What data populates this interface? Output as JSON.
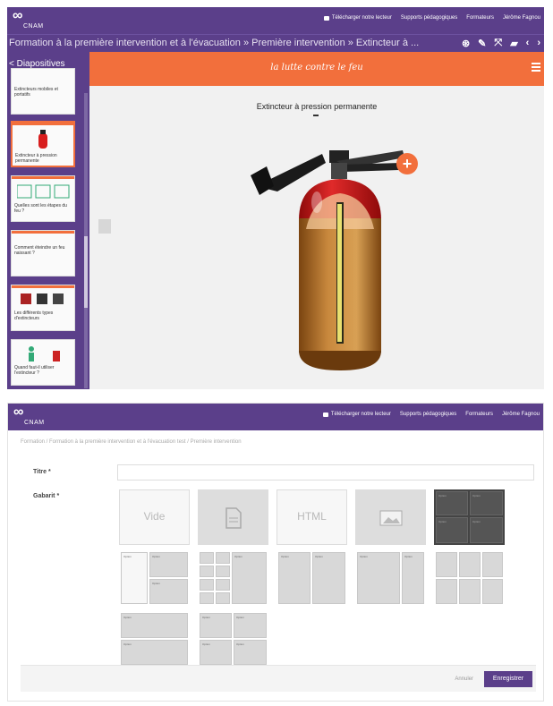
{
  "editor": {
    "app": {
      "logo_text": "CNAM"
    },
    "toplinks": [
      "Télécharger notre lecteur",
      "Supports pédagogiques",
      "Formateurs",
      "Jérôme Fagnou"
    ],
    "breadcrumb": "Formation à la première intervention et à l'évacuation » Première intervention » Extincteur à ...",
    "tools": [
      "share-icon",
      "pencil-icon",
      "expand-icon",
      "folder-icon",
      "chevron-left-icon",
      "chevron-right-icon"
    ],
    "sidebar": {
      "header": "< Diapositives",
      "slides": [
        {
          "caption": "Extincteurs mobiles et portatifs"
        },
        {
          "caption": "Extincteur à pression permanente"
        },
        {
          "caption": "Quelles sont les étapes du feu ?"
        },
        {
          "caption": "Comment éteindre un feu naissant ?"
        },
        {
          "caption": "Les différents types d'extincteurs"
        },
        {
          "caption": "Quand faut-il utiliser l'extincteur ?"
        }
      ]
    },
    "slide_header": "la lutte contre le feu",
    "slide_title": "Extincteur à pression permanente",
    "colors": {
      "brand": "#5b3f8a",
      "accent": "#f26f3c",
      "red": "#d81e1e",
      "body": "#b87730"
    }
  },
  "form": {
    "toplinks": [
      "Télécharger notre lecteur",
      "Supports pédagogiques",
      "Formateurs",
      "Jérôme Fagnou"
    ],
    "breadcrumb": "Formation / Formation à la première intervention et à l'évacuation test / Première intervention",
    "title_label": "Titre *",
    "title_value": "",
    "gabarit_label": "Gabarit *",
    "templates": [
      {
        "name": "Vide"
      },
      {
        "name": "document-icon"
      },
      {
        "name": "HTML"
      },
      {
        "name": "image-icon"
      },
      {
        "name": "quad-dark"
      }
    ],
    "cell_label": "Option",
    "cancel_label": "Annuler",
    "save_label": "Enregistrer"
  }
}
